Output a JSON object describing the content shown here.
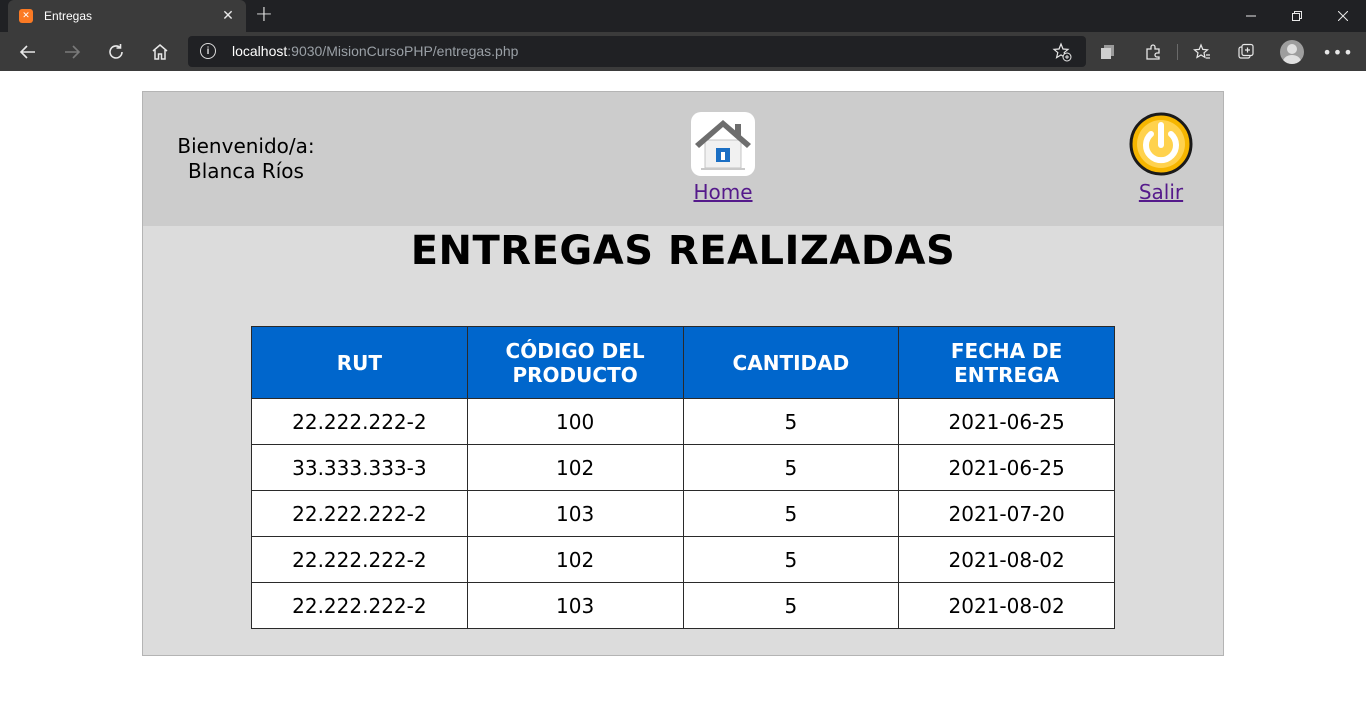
{
  "browser": {
    "tab_title": "Entregas",
    "tab_icon": "xampp-icon",
    "url_host": "localhost",
    "url_rest": ":9030/MisionCursoPHP/entregas.php"
  },
  "header": {
    "welcome_line1": "Bienvenido/a:",
    "welcome_line2": "Blanca Ríos",
    "home_label": "Home",
    "salir_label": "Salir"
  },
  "main": {
    "title": "ENTREGAS REALIZADAS",
    "table": {
      "headers": [
        "RUT",
        "CÓDIGO DEL PRODUCTO",
        "CANTIDAD",
        "FECHA DE ENTREGA"
      ],
      "rows": [
        [
          "22.222.222-2",
          "100",
          "5",
          "2021-06-25"
        ],
        [
          "33.333.333-3",
          "102",
          "5",
          "2021-06-25"
        ],
        [
          "22.222.222-2",
          "103",
          "5",
          "2021-07-20"
        ],
        [
          "22.222.222-2",
          "102",
          "5",
          "2021-08-02"
        ],
        [
          "22.222.222-2",
          "103",
          "5",
          "2021-08-02"
        ]
      ]
    }
  },
  "colors": {
    "table_header": "#0066cc",
    "page_bg": "#dcdcdc",
    "header_band": "#cccccc",
    "link": "#551a8b"
  }
}
